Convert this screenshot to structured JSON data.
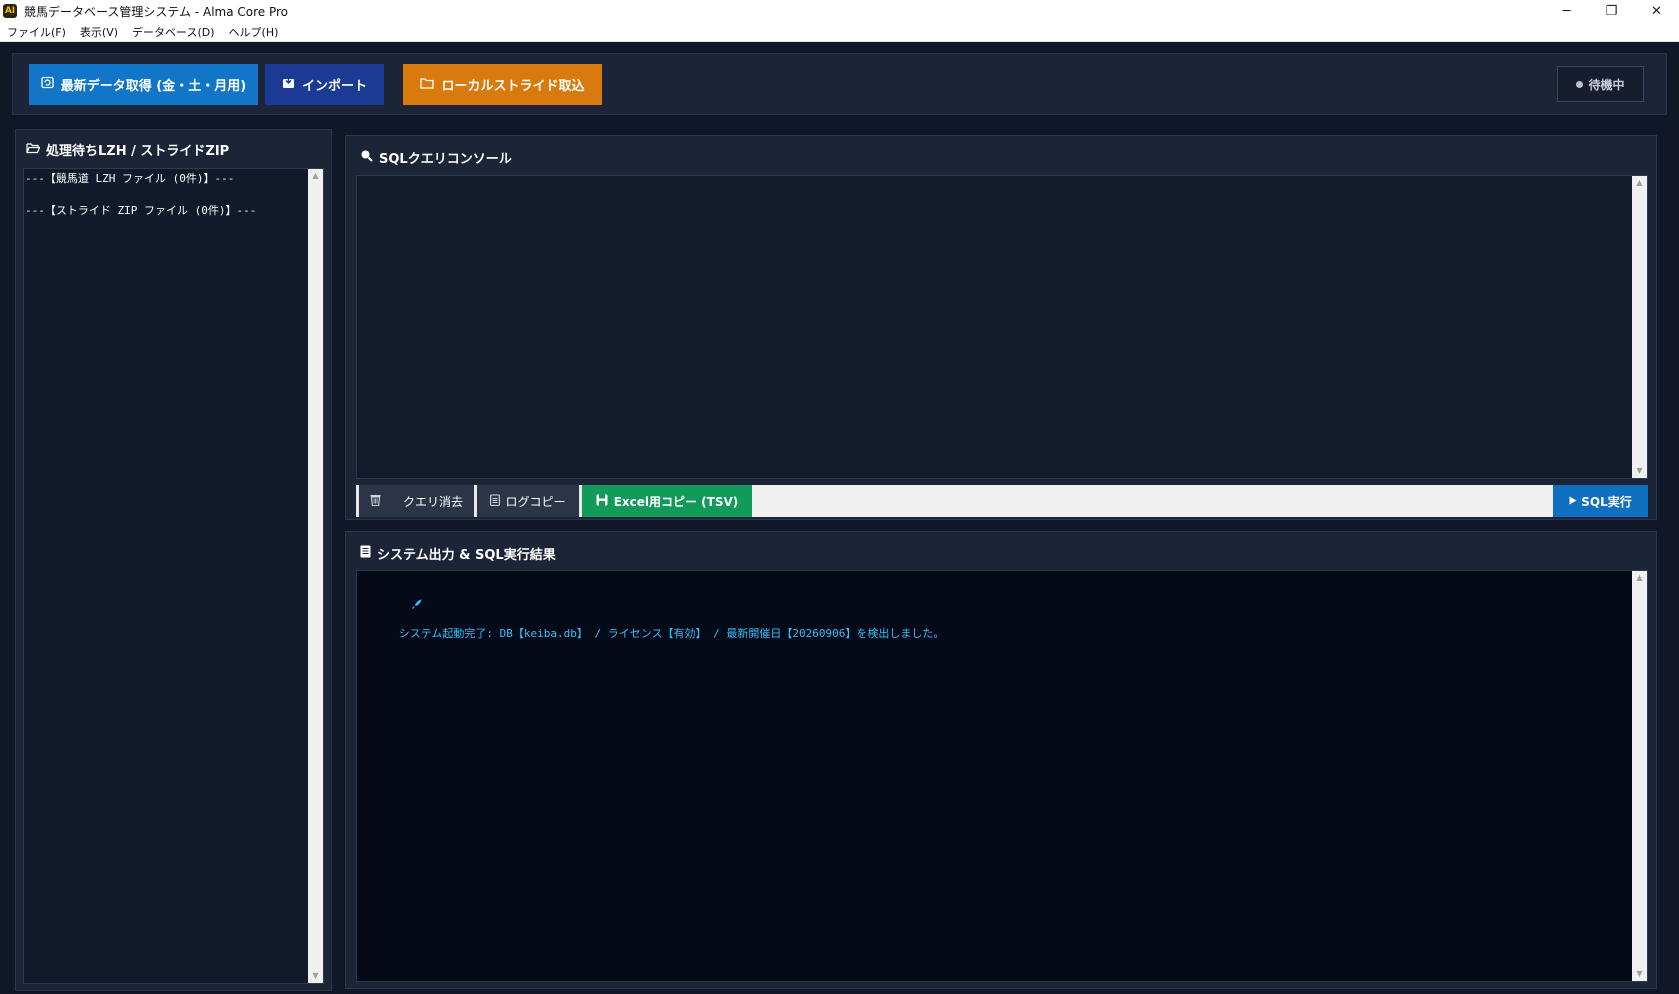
{
  "window": {
    "title": "競馬データベース管理システム - Alma Core Pro",
    "app_icon": "AI",
    "controls": {
      "minimize": "─",
      "maximize": "❐",
      "close": "✕"
    }
  },
  "menu": {
    "items": [
      {
        "label": "ファイル(F)"
      },
      {
        "label": "表示(V)"
      },
      {
        "label": "データベース(D)"
      },
      {
        "label": "ヘルプ(H)"
      }
    ]
  },
  "toolbar": {
    "fetch_label": "最新データ取得 (金・土・月用)",
    "fetch_icon": "refresh-icon",
    "import_label": "インポート",
    "import_icon": "import-icon",
    "local_label": "ローカルストライド取込",
    "local_icon": "folder-icon",
    "status_label": "待機中",
    "colors": {
      "fetch": "#1176c7",
      "import": "#1a3a94",
      "local": "#d97a0e"
    }
  },
  "left_panel": {
    "title": "処理待ちLZH / ストライドZIP",
    "icon": "folder-open-icon",
    "lines": [
      "---【競馬道 LZH ファイル (0件)】---",
      "---【ストライド ZIP ファイル (0件)】---"
    ]
  },
  "sql_console": {
    "title": "SQLクエリコンソール",
    "icon": "magnifier-icon",
    "query": "",
    "clear_label": "クエリ消去",
    "clear_icon": "trash-icon",
    "logcopy_label": "ログコピー",
    "logcopy_icon": "clipboard-icon",
    "excel_label": "Excel用コピー (TSV)",
    "excel_icon": "excel-icon",
    "run_label": "SQL実行",
    "run_icon": "play-icon",
    "colors": {
      "excel": "#119a5a",
      "run": "#0f6fc0"
    }
  },
  "output": {
    "title": "システム出力 & SQL実行結果",
    "icon": "document-icon",
    "log_icon": "rocket-icon",
    "log_line": "システム起動完了: DB【keiba.db】 / ライセンス【有効】 / 最新開催日【20260906】を検出しました。",
    "log_color": "#38bdf8"
  }
}
